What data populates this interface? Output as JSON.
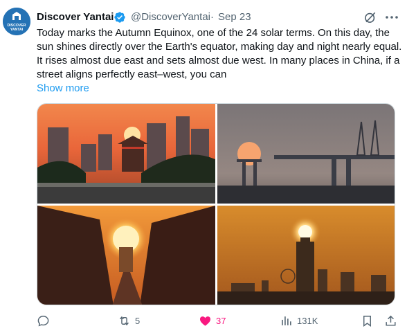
{
  "author": {
    "name": "Discover Yantai",
    "handle": "@DiscoverYantai",
    "separator": "·",
    "date": "Sep 23",
    "avatar_text_line1": "DISCOVER",
    "avatar_text_line2": "YANTAI"
  },
  "tweet": {
    "text": "Today marks the Autumn Equinox, one of the 24 solar terms. On this day, the sun shines directly over the Earth's equator, making day and night nearly equal. It rises almost due east and sets almost due west. In many places in China, if a street aligns perfectly east–west, you can",
    "show_more": "Show more"
  },
  "photos": [
    {
      "name": "sunset-pagoda-city"
    },
    {
      "name": "sunset-bridge-cranes"
    },
    {
      "name": "sunrise-street"
    },
    {
      "name": "sunset-tower-skyline"
    }
  ],
  "actions": {
    "reply_count": "",
    "retweet_count": "5",
    "like_count": "37",
    "views_count": "131K"
  },
  "colors": {
    "accent": "#1d9bf0",
    "like": "#f91880",
    "muted": "#536471"
  },
  "icons": [
    "verified-badge-icon",
    "grok-icon",
    "more-icon",
    "reply-icon",
    "retweet-icon",
    "like-icon",
    "views-icon",
    "bookmark-icon",
    "share-icon"
  ]
}
